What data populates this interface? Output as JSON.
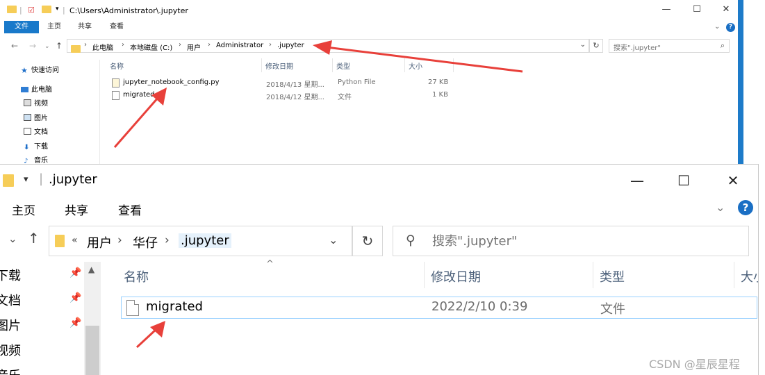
{
  "top_window": {
    "title_path": "C:\\Users\\Administrator\\.jupyter",
    "ribbon_tabs": [
      "文件",
      "主页",
      "共享",
      "查看"
    ],
    "breadcrumbs": [
      "此电脑",
      "本地磁盘 (C:)",
      "用户",
      "Administrator",
      ".jupyter"
    ],
    "search_placeholder": "搜索\".jupyter\"",
    "sidebar": [
      "快速访问",
      "此电脑",
      "视频",
      "图片",
      "文档",
      "下载",
      "音乐"
    ],
    "columns": [
      "名称",
      "修改日期",
      "类型",
      "大小"
    ],
    "files": [
      {
        "name": "jupyter_notebook_config.py",
        "date": "2018/4/13 星期...",
        "type": "Python File",
        "size": "27 KB"
      },
      {
        "name": "migrated",
        "date": "2018/4/12 星期...",
        "type": "文件",
        "size": "1 KB"
      }
    ]
  },
  "bottom_window": {
    "title": ".jupyter",
    "ribbon_tabs": [
      "主页",
      "共享",
      "查看"
    ],
    "breadcrumb_prefix": "«",
    "breadcrumbs": [
      "用户",
      "华仔",
      ".jupyter"
    ],
    "search_placeholder": "搜索\".jupyter\"",
    "sidebar": [
      "下载",
      "文档",
      "图片",
      "视频",
      "音乐"
    ],
    "columns": [
      "名称",
      "修改日期",
      "类型",
      "大小"
    ],
    "files": [
      {
        "name": "migrated",
        "date": "2022/2/10 0:39",
        "type": "文件"
      }
    ]
  },
  "watermark": "CSDN @星辰星程",
  "colors": {
    "accent": "#1979ca",
    "arrow": "#e8403a",
    "folder": "#f6cd58"
  }
}
